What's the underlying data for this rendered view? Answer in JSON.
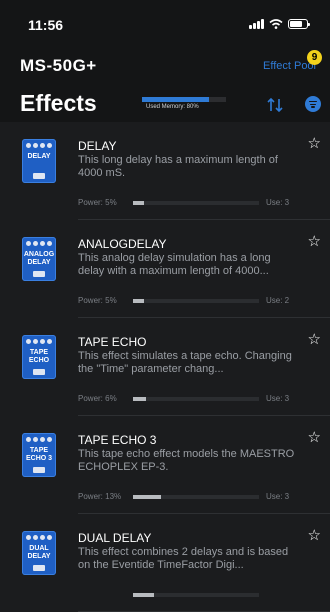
{
  "status_bar": {
    "time": "11:56"
  },
  "header": {
    "device_name": "MS-50G+",
    "effect_pool_label": "Effect Pool",
    "effect_pool_badge": "9",
    "title": "Effects",
    "memory_label": "Used Memory: 80%",
    "memory_fraction": 0.8
  },
  "colors": {
    "accent": "#2f7bd6",
    "badge": "#f3d21c",
    "thumb_blue": "#1f5fc4"
  },
  "effects": [
    {
      "name": "DELAY",
      "thumb_label": "DELAY",
      "desc": "This long delay has a maximum length of 4000 mS.",
      "power_label": "Power: 5%",
      "power_fraction": 0.05,
      "use_label": "Use: 3"
    },
    {
      "name": "ANALOGDELAY",
      "thumb_label": "ANALOG DELAY",
      "desc": "This analog delay simulation has a long delay with a maximum length of 4000...",
      "power_label": "Power: 5%",
      "power_fraction": 0.05,
      "use_label": "Use: 2"
    },
    {
      "name": "TAPE ECHO",
      "thumb_label": "TAPE ECHO",
      "desc": "This effect simulates a tape echo. Changing the \"Time\" parameter chang...",
      "power_label": "Power: 6%",
      "power_fraction": 0.06,
      "use_label": "Use: 3"
    },
    {
      "name": "TAPE ECHO 3",
      "thumb_label": "TAPE ECHO 3",
      "desc": "This tape echo effect models the MAESTRO ECHOPLEX EP-3.",
      "power_label": "Power: 13%",
      "power_fraction": 0.13,
      "use_label": "Use: 3"
    },
    {
      "name": "DUAL DELAY",
      "thumb_label": "DUAL DELAY",
      "desc": "This effect combines 2 delays and is based on the Eventide TimeFactor Digi...",
      "power_label": "",
      "power_fraction": 0.1,
      "use_label": ""
    }
  ]
}
